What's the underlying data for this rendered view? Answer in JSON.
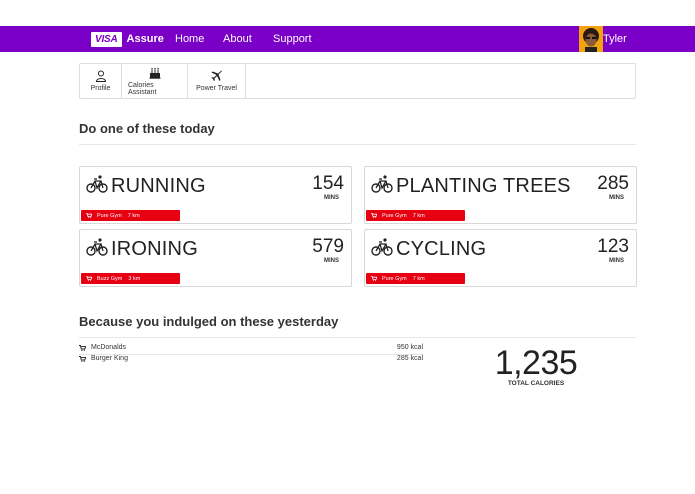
{
  "nav": {
    "logo": "VISA",
    "brand": "Assure",
    "links": [
      "Home",
      "About",
      "Support"
    ],
    "user": "Tyler"
  },
  "toolbar": [
    {
      "label": "Profile",
      "icon": "user-icon"
    },
    {
      "label": "Calories Assistant",
      "icon": "cake-icon"
    },
    {
      "label": "Power Travel",
      "icon": "plane-icon"
    }
  ],
  "today": {
    "title": "Do one of these today",
    "cards": [
      {
        "activity": "RUNNING",
        "mins": "154",
        "unit": "MINS",
        "gym": "Pure Gym",
        "distance": "7 km"
      },
      {
        "activity": "PLANTING TREES",
        "mins": "285",
        "unit": "MINS",
        "gym": "Pure Gym",
        "distance": "7 km"
      },
      {
        "activity": "IRONING",
        "mins": "579",
        "unit": "MINS",
        "gym": "Buzz Gym",
        "distance": "3 km"
      },
      {
        "activity": "CYCLING",
        "mins": "123",
        "unit": "MINS",
        "gym": "Pure Gym",
        "distance": "7 km"
      }
    ]
  },
  "yesterday": {
    "title": "Because you indulged on these yesterday",
    "items": [
      {
        "place": "McDonalds",
        "kcal": "950 kcal"
      },
      {
        "place": "Burger King",
        "kcal": "285 kcal"
      }
    ],
    "total": "1,235",
    "total_label": "TOTAL CALORIES"
  },
  "colors": {
    "nav": "#7a00c8",
    "badge": "#e60012",
    "avatar_bg": "#f2a20a"
  }
}
